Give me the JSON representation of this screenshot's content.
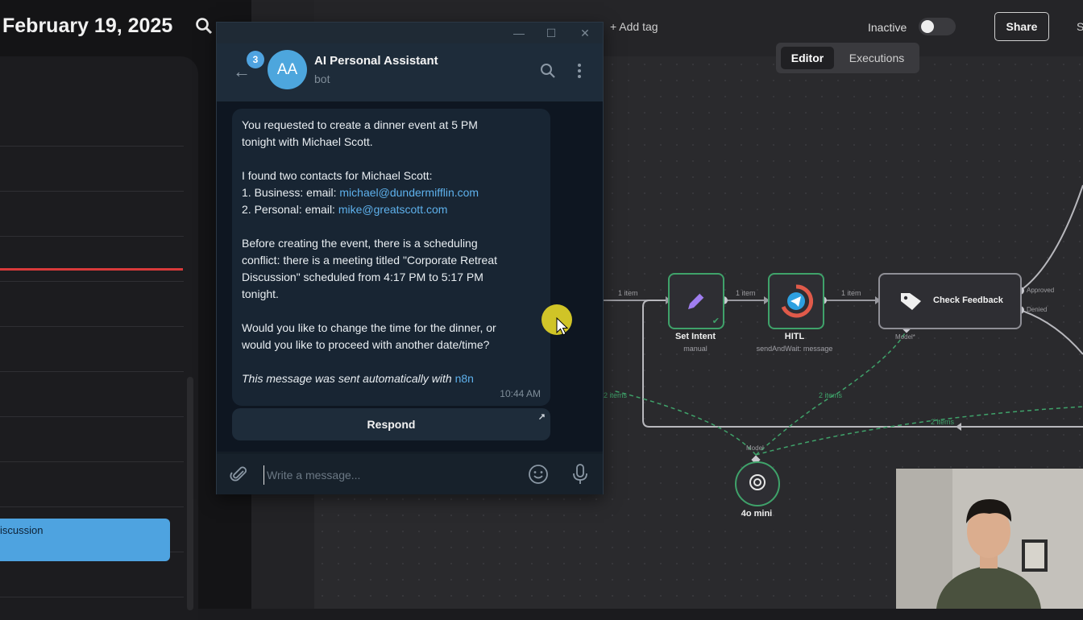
{
  "calendar": {
    "date": "February 19, 2025",
    "event_text": "iscussion"
  },
  "n8n": {
    "add_tag": "+ Add tag",
    "status_label": "Inactive",
    "share_label": "Share",
    "cut_text": "S",
    "tabs": [
      "Editor",
      "Executions"
    ],
    "nodes": {
      "set_intent": {
        "title": "Set Intent",
        "sub": "manual"
      },
      "hitl": {
        "title": "HITL",
        "sub": "sendAndWait: message"
      },
      "check_feedback": {
        "title": "Check Feedback",
        "out1": "Approved",
        "out2": "Denied",
        "port": "Model*"
      },
      "model": {
        "title": "4o mini",
        "port": "Model"
      }
    },
    "edges": [
      "1 item",
      "1 item",
      "1 item",
      "2 items",
      "2 items",
      "2 items"
    ]
  },
  "telegram": {
    "badge": "3",
    "avatar_initials": "AA",
    "chat_name": "AI Personal Assistant",
    "chat_status": "bot",
    "message_lines": [
      "You requested to create a dinner event at 5 PM",
      "tonight with Michael Scott.",
      "I found two contacts for Michael Scott:",
      "1. Business: email: ",
      "michael@dundermifflin.com",
      "2. Personal: email: ",
      "mike@greatscott.com",
      "Before creating the event, there is a scheduling",
      "conflict: there is a meeting titled \"Corporate Retreat",
      "Discussion\" scheduled from 4:17 PM to 5:17 PM",
      "tonight.",
      "Would you like to change the time for the dinner, or",
      "would you like to proceed with another date/time?",
      "This message was sent automatically with ",
      "n8n"
    ],
    "time": "10:44 AM",
    "respond_label": "Respond",
    "input_placeholder": "Write a message..."
  }
}
